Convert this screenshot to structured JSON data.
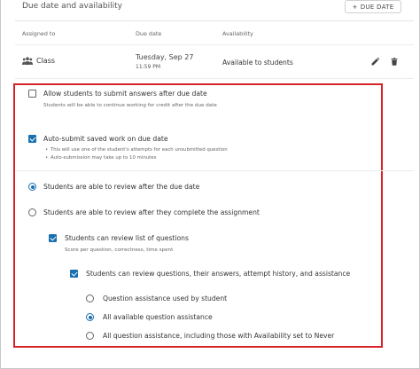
{
  "header": {
    "title": "Due date and availability",
    "due_button_label": "DUE DATE",
    "due_button_icon": "plus-icon"
  },
  "table": {
    "columns": [
      "Assigned to",
      "Due date",
      "Availability"
    ],
    "row": {
      "assigned_icon": "group-icon",
      "assigned": "Class",
      "due_date": "Tuesday, Sep 27",
      "due_time": "11:59 PM",
      "availability": "Available to students",
      "actions": [
        "edit-icon",
        "delete-icon"
      ]
    }
  },
  "options": {
    "allow_late": {
      "label": "Allow students to submit answers after due date",
      "description": "Students will be able to continue working for credit after the due date",
      "checked": false
    },
    "auto_submit": {
      "label": "Auto-submit saved work on due date",
      "bullets": [
        "This will use one of the student's attempts for each unsubmitted question",
        "Auto-submission may take up to 10 minutes"
      ],
      "checked": true
    },
    "review_after_due": {
      "label": "Students are able to review after the due date",
      "selected": true
    },
    "review_after_complete": {
      "label": "Students are able to review after they complete the assignment",
      "selected": false
    },
    "review_list": {
      "label": "Students can review list of questions",
      "description": "Score per question, correctness, time spent",
      "checked": true
    },
    "review_questions": {
      "label": "Students can review questions, their answers, attempt history, and assistance",
      "checked": true
    },
    "assistance": [
      {
        "label": "Question assistance used by student",
        "selected": false
      },
      {
        "label": "All available question assistance",
        "selected": true
      },
      {
        "label": "All question assistance, including those with Availability set to Never",
        "selected": false
      }
    ]
  },
  "colors": {
    "accent": "#1a6fb0",
    "highlight_box": "#d8222a"
  }
}
